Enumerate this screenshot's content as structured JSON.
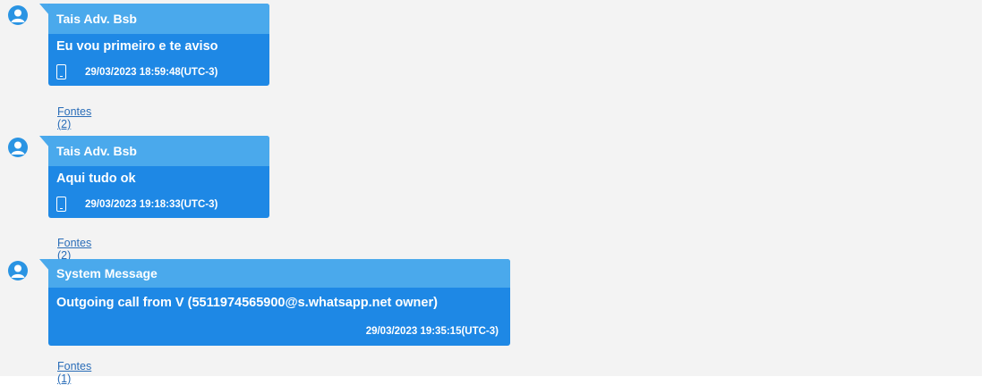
{
  "messages": [
    {
      "sender": "Tais Adv. Bsb",
      "text": "Eu vou primeiro e te aviso",
      "timestamp": "29/03/2023 18:59:48(UTC-3)",
      "device_icon": "phone-icon",
      "sources_link": "Fontes (2)"
    },
    {
      "sender": "Tais Adv. Bsb",
      "text": "Aqui tudo ok",
      "timestamp": "29/03/2023 19:18:33(UTC-3)",
      "device_icon": "phone-icon",
      "sources_link": "Fontes (2)"
    },
    {
      "sender": "System Message",
      "text": "Outgoing call from V (5511974565900@s.whatsapp.net owner)",
      "timestamp": "29/03/2023 19:35:15(UTC-3)",
      "sources_link": "Fontes (1)"
    }
  ],
  "colors": {
    "bubble": "#1e88e5",
    "bubble_header": "#4aa9ec",
    "background": "#f3f3f3",
    "link": "#2a6db8"
  }
}
